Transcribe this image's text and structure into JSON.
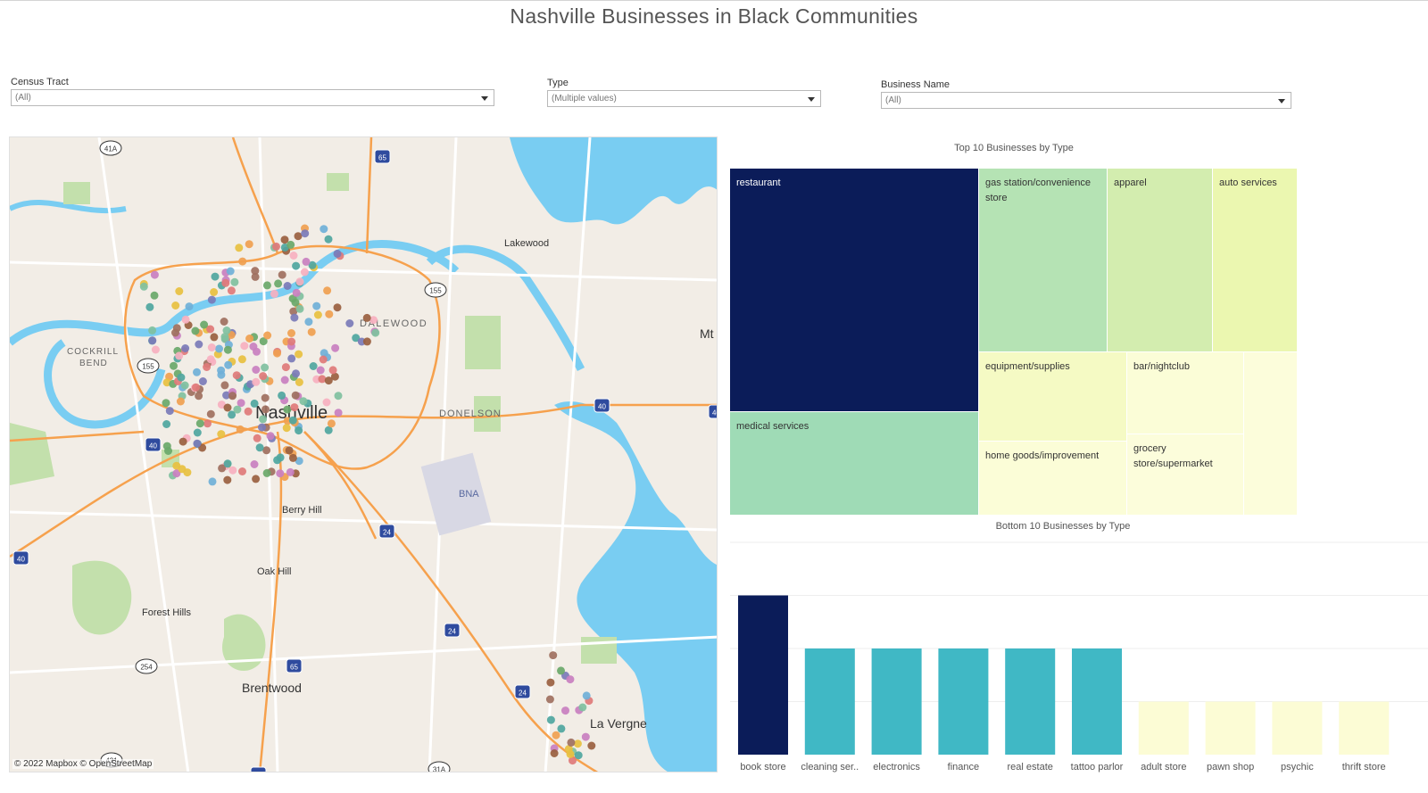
{
  "dashboard": {
    "title": "Nashville Businesses in Black Communities"
  },
  "filters": {
    "census_tract": {
      "label": "Census Tract",
      "value": "(All)"
    },
    "type": {
      "label": "Type",
      "value": "(Multiple values)"
    },
    "business_name": {
      "label": "Business Name",
      "value": "(All)"
    }
  },
  "map": {
    "attribution": "© 2022 Mapbox © OpenStreetMap",
    "place_labels": [
      "Nashville",
      "Lakewood",
      "DALEWOOD",
      "COCKRILL",
      "BEND",
      "DONELSON",
      "BNA",
      "Berry Hill",
      "Oak Hill",
      "Forest Hills",
      "Brentwood",
      "La Vergne",
      "Mt"
    ],
    "route_shields": [
      "41A",
      "65",
      "155",
      "155",
      "40",
      "40",
      "40",
      "40",
      "24",
      "24",
      "24",
      "65",
      "254",
      "431",
      "65",
      "31A"
    ],
    "colors": {
      "land": "#f2ede6",
      "water": "#79cdf2",
      "park": "#c3e0ac",
      "highway": "#f6a14d",
      "road": "#ffffff"
    }
  },
  "treemap": {
    "title": "Top 10 Businesses by Type",
    "cells": [
      {
        "label": "restaurant",
        "color": "#0b1c59",
        "text_color": "#ffffff"
      },
      {
        "label": "medical services",
        "color": "#9fdbb6",
        "text_color": "#333333"
      },
      {
        "label": "gas station/convenience store",
        "color": "#b5e3b4",
        "text_color": "#333333"
      },
      {
        "label": "apparel",
        "color": "#d3edaf",
        "text_color": "#333333"
      },
      {
        "label": "auto services",
        "color": "#ebf7b0",
        "text_color": "#333333"
      },
      {
        "label": "equipment/supplies",
        "color": "#f5fac4",
        "text_color": "#333333"
      },
      {
        "label": "bar/nightclub",
        "color": "#fbfdd7",
        "text_color": "#333333"
      },
      {
        "label": "home goods/improvement",
        "color": "#fbfdd7",
        "text_color": "#333333"
      },
      {
        "label": "grocery store/supermarket",
        "color": "#fcfddb",
        "text_color": "#333333"
      },
      {
        "label": "",
        "color": "#fcfddb",
        "text_color": "#333333"
      }
    ]
  },
  "chart_data": {
    "type": "bar",
    "title": "Bottom 10 Businesses by Type",
    "categories": [
      "book store",
      "cleaning ser..",
      "electronics",
      "finance",
      "real estate",
      "tattoo parlor",
      "adult store",
      "pawn shop",
      "psychic",
      "thrift store"
    ],
    "values": [
      3,
      2,
      2,
      2,
      2,
      2,
      1,
      1,
      1,
      1
    ],
    "colors": [
      "#0b1c59",
      "#40b8c5",
      "#40b8c5",
      "#40b8c5",
      "#40b8c5",
      "#40b8c5",
      "#fcfcd5",
      "#fcfcd5",
      "#fcfcd5",
      "#fcfcd5"
    ],
    "ylim": [
      0,
      4
    ],
    "grid": true
  }
}
